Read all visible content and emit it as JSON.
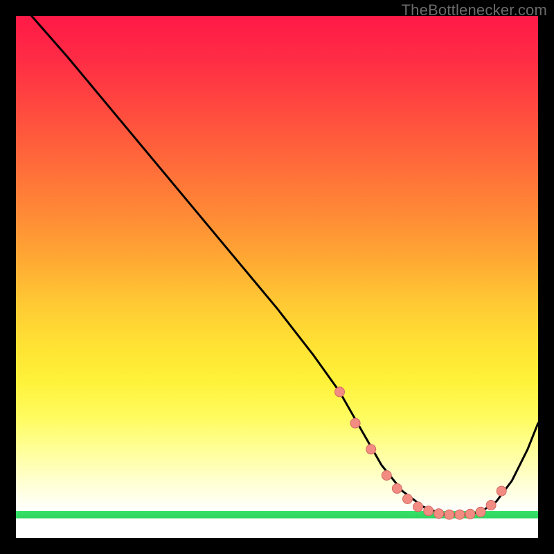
{
  "watermark": "TheBottlenecker.com",
  "colors": {
    "curve": "#000000",
    "dot_fill": "#f28b82",
    "dot_stroke": "#d36b62",
    "green_band": "#37e26a"
  },
  "chart_data": {
    "type": "line",
    "title": "",
    "xlabel": "",
    "ylabel": "",
    "xlim": [
      0,
      100
    ],
    "ylim": [
      0,
      100
    ],
    "series": [
      {
        "name": "curve",
        "x": [
          3,
          10,
          20,
          30,
          40,
          50,
          57,
          62,
          66,
          70,
          74,
          78,
          82,
          86,
          89,
          92,
          95,
          98,
          100
        ],
        "y": [
          100,
          92,
          80,
          68,
          56,
          44,
          35,
          28,
          21,
          14,
          9,
          6,
          4.5,
          4.5,
          5,
          7,
          11,
          17,
          22
        ]
      }
    ],
    "dot_points": {
      "x": [
        62,
        65,
        68,
        71,
        73,
        75,
        77,
        79,
        81,
        83,
        85,
        87,
        89,
        91,
        93
      ],
      "y": [
        28,
        22,
        17,
        12,
        9.5,
        7.5,
        6,
        5.2,
        4.7,
        4.5,
        4.5,
        4.6,
        5,
        6.3,
        9
      ]
    }
  }
}
